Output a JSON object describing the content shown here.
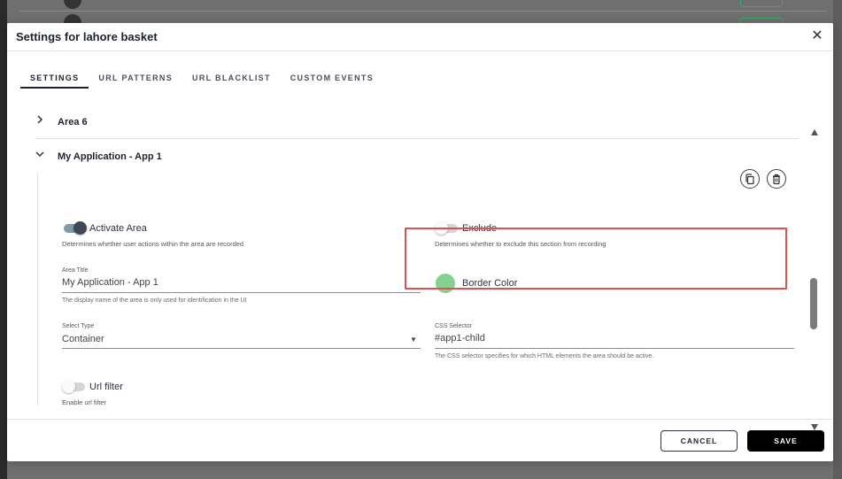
{
  "modal": {
    "title": "Settings for lahore basket",
    "close_glyph": "✕"
  },
  "tabs": [
    {
      "label": "SETTINGS",
      "active": true
    },
    {
      "label": "URL PATTERNS",
      "active": false
    },
    {
      "label": "URL BLACKLIST",
      "active": false
    },
    {
      "label": "CUSTOM EVENTS",
      "active": false
    }
  ],
  "areas": [
    {
      "title": "Area 6",
      "expanded": false
    },
    {
      "title": "My Application - App 1",
      "expanded": true
    }
  ],
  "area_actions": {
    "copy_icon": "copy-icon",
    "delete_icon": "trash-icon"
  },
  "activate_area": {
    "label": "Activate Area",
    "on": true,
    "description": "Determines whether user actions within the area are recorded."
  },
  "exclude": {
    "label": "Exclude",
    "on": false,
    "description": "Determines whether to exclude this section from recording"
  },
  "area_title": {
    "label": "Area Title",
    "value": "My Application - App 1",
    "help": "The display name of the area is only used for identification in the UI"
  },
  "border_color": {
    "label": "Border Color",
    "color": "#86d18f"
  },
  "select_type": {
    "label": "Select Type",
    "value": "Container"
  },
  "css_selector": {
    "label": "CSS Selector",
    "value": "#app1-child",
    "help": "The CSS selector specifies for which HTML elements the area should be active."
  },
  "url_filter": {
    "label": "Url filter",
    "on": false,
    "description": "Enable url filter"
  },
  "footer": {
    "cancel_label": "CANCEL",
    "save_label": "SAVE"
  }
}
